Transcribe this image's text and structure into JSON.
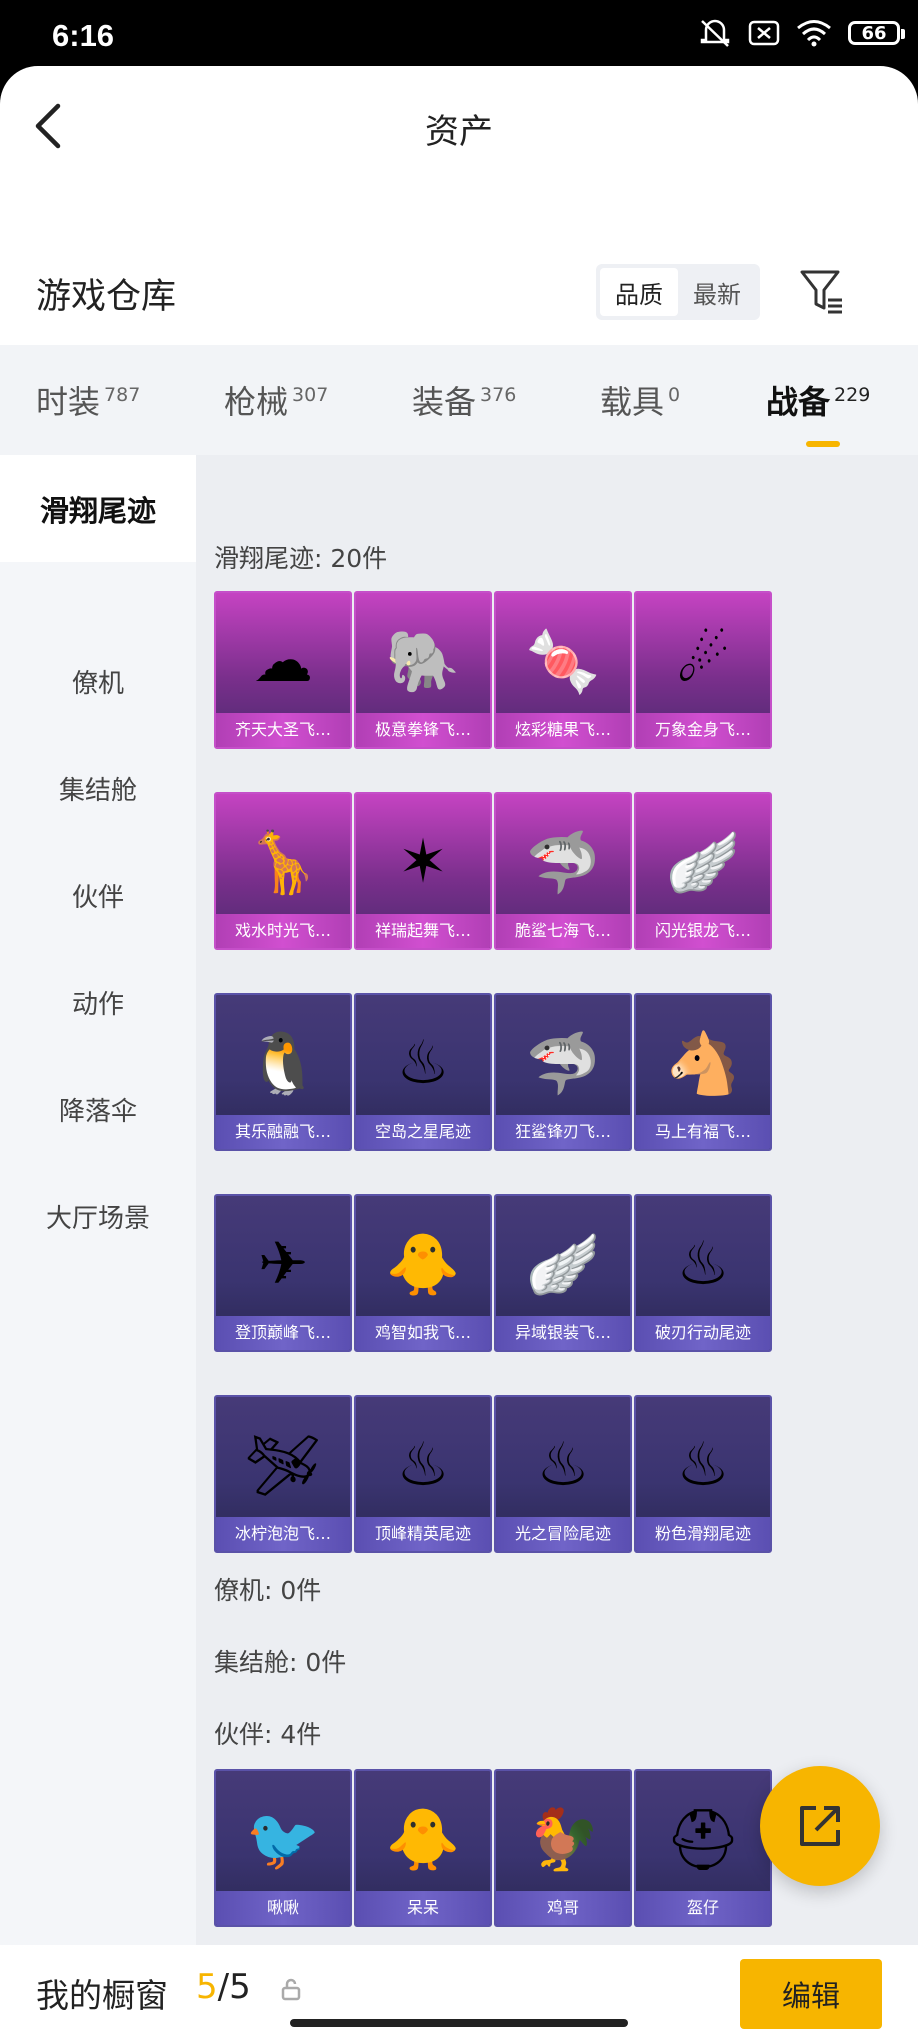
{
  "status_bar": {
    "time": "6:16",
    "battery": "66",
    "icons": [
      "mute-icon",
      "close-box-icon",
      "wifi-icon",
      "battery-icon"
    ]
  },
  "header": {
    "title": "资产"
  },
  "warehouse": {
    "title": "游戏仓库",
    "sort_options": [
      "品质",
      "最新"
    ],
    "active_sort": "品质"
  },
  "tabs": [
    {
      "label": "时装",
      "count": "787"
    },
    {
      "label": "枪械",
      "count": "307"
    },
    {
      "label": "装备",
      "count": "376"
    },
    {
      "label": "载具",
      "count": "0"
    },
    {
      "label": "战备",
      "count": "229"
    }
  ],
  "active_tab": "战备",
  "sidebar": {
    "items": [
      "滑翔尾迹",
      "僚机",
      "集结舱",
      "伙伴",
      "动作",
      "降落伞",
      "大厅场景"
    ],
    "active": "滑翔尾迹"
  },
  "sections": {
    "glide": "滑翔尾迹: 20件",
    "wingman": "僚机: 0件",
    "pod": "集结舱: 0件",
    "partner": "伙伴: 4件"
  },
  "glide_items": [
    {
      "name": "齐天大圣飞…",
      "rarity": "purple",
      "icon": "cloud-icon"
    },
    {
      "name": "极意拳锋飞…",
      "rarity": "purple",
      "icon": "elephant-icon"
    },
    {
      "name": "炫彩糖果飞…",
      "rarity": "purple",
      "icon": "candy-icon"
    },
    {
      "name": "万象金身飞…",
      "rarity": "purple",
      "icon": "fire-trail-icon"
    },
    {
      "name": "戏水时光飞…",
      "rarity": "purple",
      "icon": "giraffe-icon"
    },
    {
      "name": "祥瑞起舞飞…",
      "rarity": "purple",
      "icon": "ribbon-icon"
    },
    {
      "name": "脆鲨七海飞…",
      "rarity": "purple",
      "icon": "shark-icon"
    },
    {
      "name": "闪光银龙飞…",
      "rarity": "purple",
      "icon": "wing-icon"
    },
    {
      "name": "其乐融融飞…",
      "rarity": "blue",
      "icon": "penguin-icon"
    },
    {
      "name": "空岛之星尾迹",
      "rarity": "blue",
      "icon": "smoke-trail-icon"
    },
    {
      "name": "狂鲨锋刃飞…",
      "rarity": "blue",
      "icon": "shark-icon"
    },
    {
      "name": "马上有福飞…",
      "rarity": "blue",
      "icon": "horse-icon"
    },
    {
      "name": "登顶巅峰飞…",
      "rarity": "blue",
      "icon": "jet-icon"
    },
    {
      "name": "鸡智如我飞…",
      "rarity": "blue",
      "icon": "chick-icon"
    },
    {
      "name": "异域银装飞…",
      "rarity": "blue",
      "icon": "wing-icon"
    },
    {
      "name": "破刃行动尾迹",
      "rarity": "blue",
      "icon": "smoke-trail-icon"
    },
    {
      "name": "冰柠泡泡飞…",
      "rarity": "blue",
      "icon": "glider-icon"
    },
    {
      "name": "顶峰精英尾迹",
      "rarity": "blue",
      "icon": "smoke-trail-icon"
    },
    {
      "name": "光之冒险尾迹",
      "rarity": "blue",
      "icon": "smoke-trail-icon"
    },
    {
      "name": "粉色滑翔尾迹",
      "rarity": "blue",
      "icon": "smoke-trail-icon"
    }
  ],
  "partner_items": [
    {
      "name": "啾啾",
      "rarity": "blue",
      "icon": "bird-icon"
    },
    {
      "name": "呆呆",
      "rarity": "blue",
      "icon": "chick-icon"
    },
    {
      "name": "鸡哥",
      "rarity": "blue",
      "icon": "rooster-icon"
    },
    {
      "name": "盔仔",
      "rarity": "blue",
      "icon": "helmet-icon"
    }
  ],
  "bottom_bar": {
    "label": "我的橱窗",
    "count_current": "5",
    "count_total": "/5",
    "edit_label": "编辑"
  },
  "colors": {
    "accent": "#f7b500",
    "purple_card": "#c543c2",
    "blue_card": "#463a78"
  }
}
